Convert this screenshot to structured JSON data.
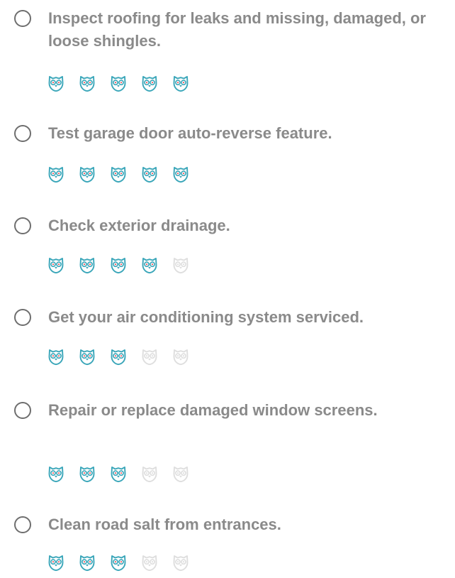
{
  "colors": {
    "owl_active": "#3aa6b9",
    "owl_inactive": "#dedede",
    "eye_active": "#e8585e",
    "eye_inactive": "#dedede",
    "text": "#8a8a8a",
    "checkbox_border": "#6e6e6e"
  },
  "rating_icon": "owl-icon",
  "rating_max": 5,
  "tasks": [
    {
      "title": "Inspect roofing for leaks and missing, damaged, or loose shingles.",
      "rating": 5,
      "checked": false
    },
    {
      "title": "Test garage door auto-reverse feature.",
      "rating": 5,
      "checked": false
    },
    {
      "title": "Check exterior drainage.",
      "rating": 4,
      "checked": false
    },
    {
      "title": "Get your air conditioning system serviced.",
      "rating": 3,
      "checked": false
    },
    {
      "title": "Repair or replace damaged window screens.",
      "rating": 3,
      "checked": false
    },
    {
      "title": "Clean road salt from entrances.",
      "rating": 3,
      "checked": false
    }
  ]
}
